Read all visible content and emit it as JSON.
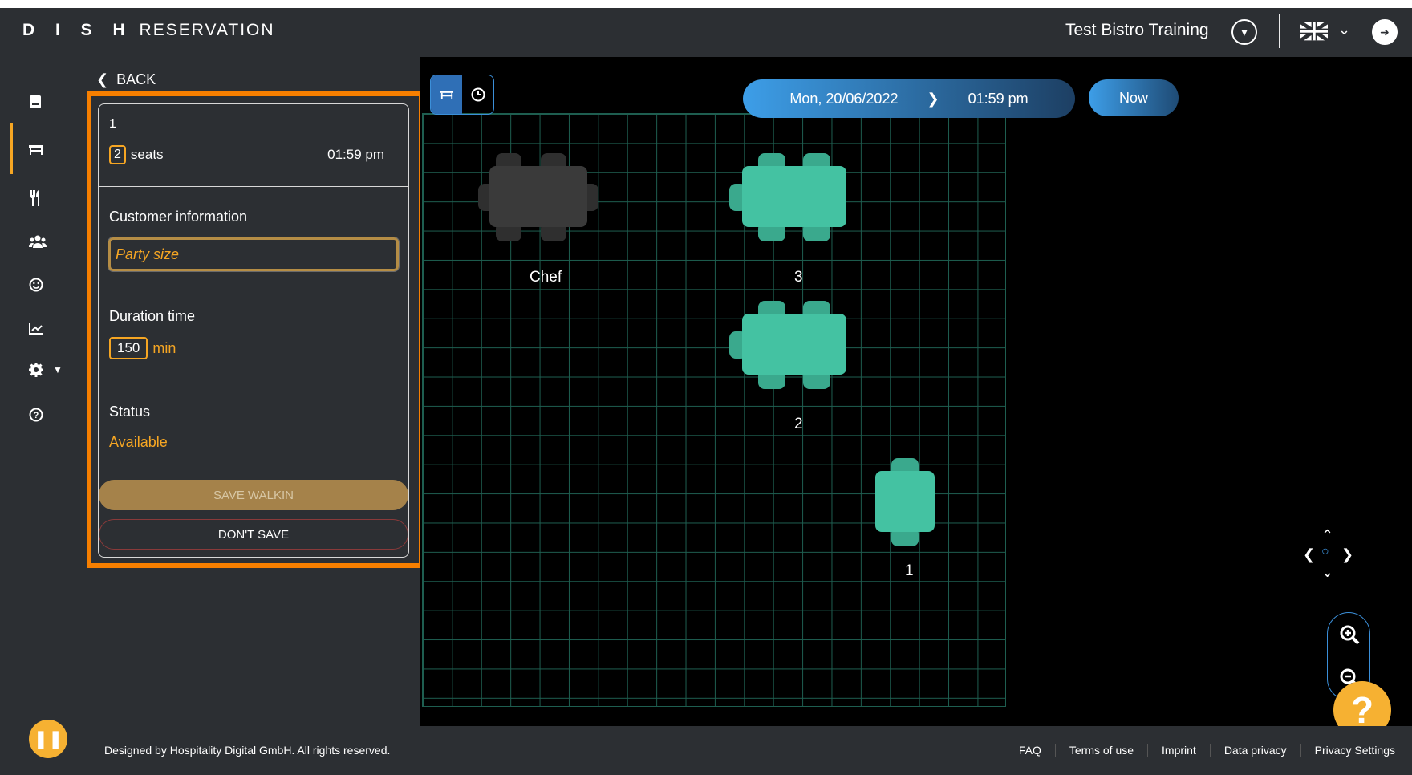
{
  "header": {
    "brand_bold": "D I S H",
    "brand_light": "RESERVATION",
    "restaurant": "Test Bistro Training"
  },
  "sidebar": {
    "items": [
      {
        "name": "book-icon",
        "glyph": "▤"
      },
      {
        "name": "table-icon",
        "glyph": "╤"
      },
      {
        "name": "cutlery-icon",
        "glyph": "🍴"
      },
      {
        "name": "users-icon",
        "glyph": "👥"
      },
      {
        "name": "smiley-icon",
        "glyph": "☺"
      },
      {
        "name": "chart-icon",
        "glyph": "📈"
      },
      {
        "name": "gear-icon",
        "glyph": "⚙"
      },
      {
        "name": "help-circle-icon",
        "glyph": "?"
      }
    ]
  },
  "panel": {
    "back_label": "BACK",
    "table_number": "1",
    "seat_count": "2",
    "seats_label": "seats",
    "time": "01:59 pm",
    "customer_info_label": "Customer information",
    "party_size_placeholder": "Party size",
    "duration_label": "Duration time",
    "duration_value": "150",
    "duration_unit": "min",
    "status_label": "Status",
    "status_value": "Available",
    "save_label": "SAVE WALKIN",
    "dont_save_label": "DON'T SAVE"
  },
  "floor": {
    "date": "Mon, 20/06/2022",
    "time": "01:59 pm",
    "now_label": "Now",
    "tables": [
      {
        "label": "Chef",
        "state": "occupied",
        "color": "#3a3a3a"
      },
      {
        "label": "3",
        "state": "available",
        "color": "#44c2a2"
      },
      {
        "label": "2",
        "state": "available",
        "color": "#44c2a2"
      },
      {
        "label": "1",
        "state": "available",
        "color": "#44c2a2"
      }
    ]
  },
  "footer": {
    "copyright": "Designed by Hospitality Digital GmbH. All rights reserved.",
    "links": [
      "FAQ",
      "Terms of use",
      "Imprint",
      "Data privacy",
      "Privacy Settings"
    ]
  },
  "colors": {
    "accent": "#f6a623",
    "highlight": "#f77f00",
    "available": "#44c2a2",
    "occupied": "#3a3a3a",
    "panel_bg": "#2c2f33"
  }
}
